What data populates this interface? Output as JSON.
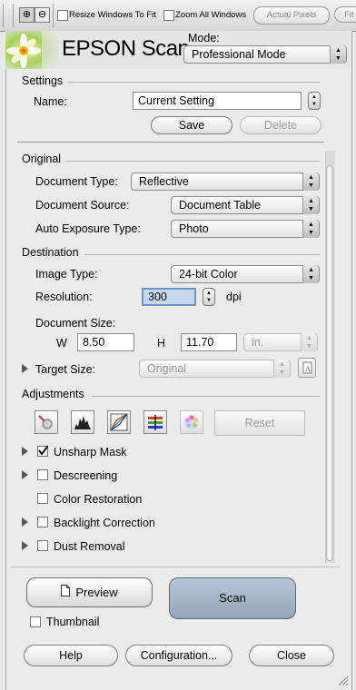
{
  "toolbar": {
    "resize_windows_label": "Resize Windows To Fit",
    "zoom_all_label": "Zoom All Windows",
    "actual_pixels_label": "Actual Pixels",
    "fit_label": "Fit"
  },
  "header": {
    "title": "EPSON Scan",
    "mode_label": "Mode:",
    "mode_value": "Professional Mode"
  },
  "settings": {
    "section_label": "Settings",
    "name_label": "Name:",
    "name_value": "Current Setting",
    "save_label": "Save",
    "delete_label": "Delete"
  },
  "original": {
    "section_label": "Original",
    "document_type_label": "Document Type:",
    "document_type_value": "Reflective",
    "document_source_label": "Document Source:",
    "document_source_value": "Document Table",
    "auto_exposure_label": "Auto Exposure Type:",
    "auto_exposure_value": "Photo"
  },
  "destination": {
    "section_label": "Destination",
    "image_type_label": "Image Type:",
    "image_type_value": "24-bit Color",
    "resolution_label": "Resolution:",
    "resolution_value": "300",
    "resolution_unit": "dpi",
    "document_size_label": "Document Size:",
    "width_label": "W",
    "width_value": "8.50",
    "height_label": "H",
    "height_value": "11.70",
    "unit_value": "in.",
    "target_size_label": "Target Size:",
    "target_size_value": "Original"
  },
  "adjustments": {
    "section_label": "Adjustments",
    "reset_label": "Reset",
    "items": [
      {
        "label": "Unsharp Mask",
        "checked": true
      },
      {
        "label": "Descreening",
        "checked": false
      },
      {
        "label": "Color Restoration",
        "checked": false
      },
      {
        "label": "Backlight Correction",
        "checked": false
      },
      {
        "label": "Dust Removal",
        "checked": false
      }
    ]
  },
  "actions": {
    "preview_label": "Preview",
    "scan_label": "Scan",
    "thumbnail_label": "Thumbnail",
    "help_label": "Help",
    "configuration_label": "Configuration...",
    "close_label": "Close"
  },
  "colors": {
    "scan_button": "#9fb1c2",
    "resolution_field_border": "#6d95c9"
  }
}
